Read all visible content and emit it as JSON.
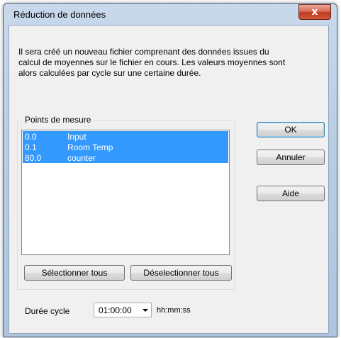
{
  "window": {
    "title": "Réduction de données",
    "close_glyph": "x"
  },
  "description": "Il sera créé un nouveau fichier comprenant des données issues du calcul de moyennes sur le fichier en cours. Les valeurs moyennes sont alors calculées par cycle sur une certaine durée.",
  "points_group": {
    "label": "Points de mesure",
    "items": [
      {
        "id": "0.0",
        "name": "Input",
        "selected": true
      },
      {
        "id": "0.1",
        "name": "Room Temp",
        "selected": true
      },
      {
        "id": "80.0",
        "name": "counter",
        "selected": true
      }
    ],
    "select_all_label": "Sélectionner tous",
    "deselect_all_label": "Déselectionner tous"
  },
  "buttons": {
    "ok_label": "OK",
    "cancel_label": "Annuler",
    "help_label": "Aide"
  },
  "cycle": {
    "label": "Durée cycle",
    "value": "01:00:00",
    "unit": "hh:mm:ss"
  },
  "colors": {
    "selection": "#3399ff",
    "close_button": "#c0391f"
  }
}
